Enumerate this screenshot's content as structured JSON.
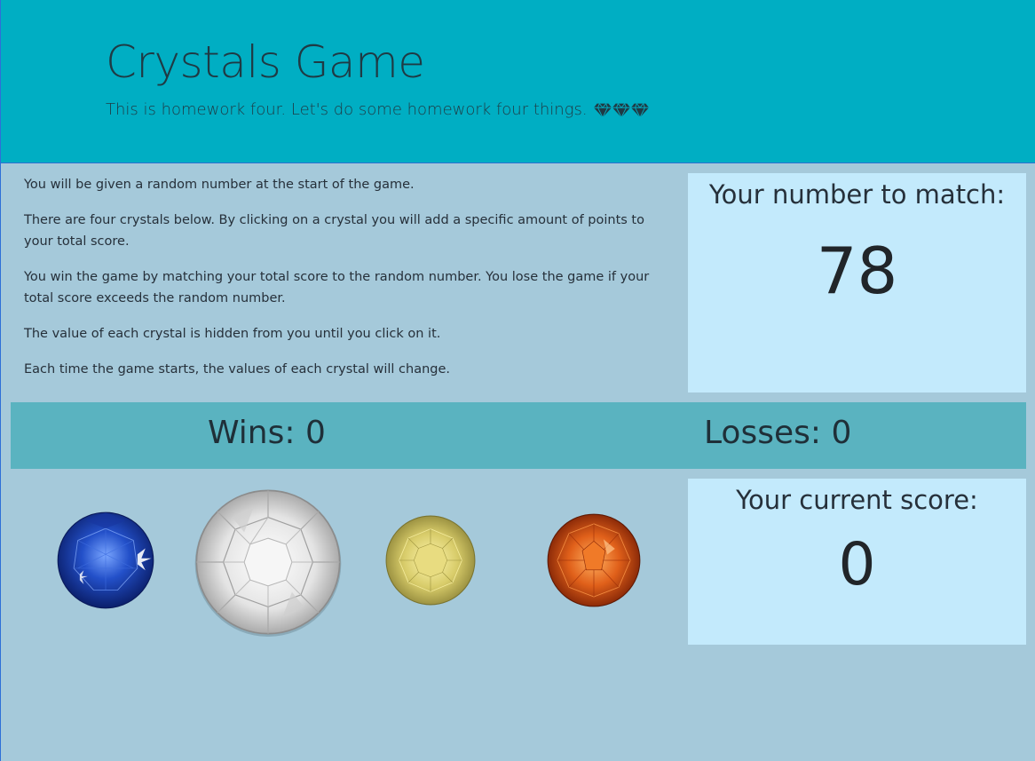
{
  "header": {
    "title": "Crystals Game",
    "subtitle": "This is homework four. Let's do some homework four things."
  },
  "instructions": [
    "You will be given a random number at the start of the game.",
    "There are four crystals below. By clicking on a crystal you will add a specific amount of points to your total score.",
    "You win the game by matching your total score to the random number. You lose the game if your total score exceeds the random number.",
    "The value of each crystal is hidden from you until you click on it.",
    "Each time the game starts, the values of each crystal will change."
  ],
  "target": {
    "label": "Your number to match:",
    "value": "78"
  },
  "stats": {
    "wins": "Wins: 0",
    "losses": "Losses: 0"
  },
  "score": {
    "label": "Your current score:",
    "value": "0"
  },
  "crystals": [
    {
      "icon": "blue-sapphire-crystal",
      "color": "#1a3fa8"
    },
    {
      "icon": "white-diamond-crystal",
      "color": "#e8e8e8"
    },
    {
      "icon": "yellow-crystal",
      "color": "#d9cf6a"
    },
    {
      "icon": "orange-crystal",
      "color": "#d45a12"
    }
  ],
  "colors": {
    "header_bg": "#00aec3",
    "page_bg": "#a5c9da",
    "panel_bg": "#c3eafc",
    "stats_bg": "#5ab3c0"
  }
}
